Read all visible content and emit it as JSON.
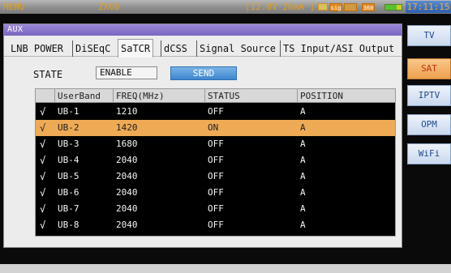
{
  "statusbar": {
    "menu_label": "MENU",
    "model": "ZX6B",
    "power": "[12.8V 26mA ]",
    "indicators": [
      "sig",
      "",
      "360"
    ],
    "clock": "17:11:15"
  },
  "dialog": {
    "title": "AUX",
    "tabs": [
      {
        "label": "LNB POWER"
      },
      {
        "label": "DiSEqC"
      },
      {
        "label": "SaTCR"
      },
      {
        "label": "dCSS"
      },
      {
        "label": "Signal Source"
      },
      {
        "label": "TS Input/ASI Output"
      }
    ],
    "state_label": "STATE",
    "state_value": "ENABLE",
    "send_label": "SEND",
    "table": {
      "headers": [
        "",
        "UserBand",
        "FREQ(MHz)",
        "STATUS",
        "POSITION"
      ],
      "rows": [
        {
          "check": "√",
          "band": "UB-1",
          "freq": "1210",
          "status": "OFF",
          "pos": "A"
        },
        {
          "check": "√",
          "band": "UB-2",
          "freq": "1420",
          "status": "ON",
          "pos": "A"
        },
        {
          "check": "√",
          "band": "UB-3",
          "freq": "1680",
          "status": "OFF",
          "pos": "A"
        },
        {
          "check": "√",
          "band": "UB-4",
          "freq": "2040",
          "status": "OFF",
          "pos": "A"
        },
        {
          "check": "√",
          "band": "UB-5",
          "freq": "2040",
          "status": "OFF",
          "pos": "A"
        },
        {
          "check": "√",
          "band": "UB-6",
          "freq": "2040",
          "status": "OFF",
          "pos": "A"
        },
        {
          "check": "√",
          "band": "UB-7",
          "freq": "2040",
          "status": "OFF",
          "pos": "A"
        },
        {
          "check": "√",
          "band": "UB-8",
          "freq": "2040",
          "status": "OFF",
          "pos": "A"
        }
      ]
    }
  },
  "sidebar": {
    "items": [
      {
        "label": "TV"
      },
      {
        "label": "SAT"
      },
      {
        "label": "IPTV"
      },
      {
        "label": "OPM"
      },
      {
        "label": "WiFi"
      }
    ]
  },
  "colors": {
    "selected_row": "#eeaa55",
    "title_bar": "#8a76cc",
    "send_button": "#5a9ddd",
    "active_side": "#eea050"
  }
}
